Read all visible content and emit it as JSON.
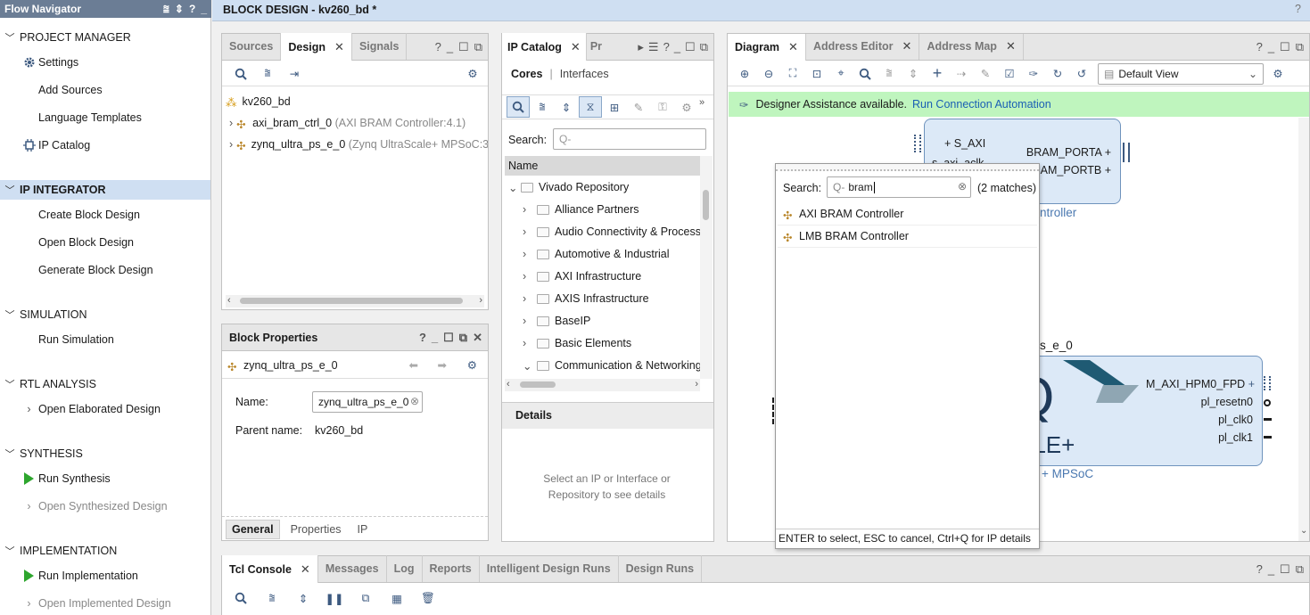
{
  "flow_navigator": {
    "title": "Flow Navigator",
    "sections": {
      "project_manager": "PROJECT MANAGER",
      "ip_integrator": "IP INTEGRATOR",
      "simulation": "SIMULATION",
      "rtl_analysis": "RTL ANALYSIS",
      "synthesis": "SYNTHESIS",
      "implementation": "IMPLEMENTATION"
    },
    "items": {
      "settings": "Settings",
      "add_sources": "Add Sources",
      "language_templates": "Language Templates",
      "ip_catalog": "IP Catalog",
      "create_block_design": "Create Block Design",
      "open_block_design": "Open Block Design",
      "generate_block_design": "Generate Block Design",
      "run_simulation": "Run Simulation",
      "open_elaborated_design": "Open Elaborated Design",
      "run_synthesis": "Run Synthesis",
      "open_synthesized_design": "Open Synthesized Design",
      "run_implementation": "Run Implementation",
      "open_implemented_design": "Open Implemented Design"
    }
  },
  "block_design_title": "BLOCK DESIGN - kv260_bd *",
  "sources_panel": {
    "tabs": [
      "Sources",
      "Design",
      "Signals"
    ],
    "root": "kv260_bd",
    "children": [
      {
        "name": "axi_bram_ctrl_0",
        "detail": "(AXI BRAM Controller:4.1)"
      },
      {
        "name": "zynq_ultra_ps_e_0",
        "detail": "(Zynq UltraScale+ MPSoC:3"
      }
    ]
  },
  "block_properties": {
    "title": "Block Properties",
    "selected": "zynq_ultra_ps_e_0",
    "name_label": "Name:",
    "name_value": "zynq_ultra_ps_e_0",
    "parent_label": "Parent name:",
    "parent_value": "kv260_bd",
    "tabs": [
      "General",
      "Properties",
      "IP"
    ]
  },
  "ip_catalog": {
    "tab": "IP Catalog",
    "tab2": "Pr",
    "cores": "Cores",
    "sep": "|",
    "interfaces": "Interfaces",
    "search_label": "Search:",
    "search_placeholder": "Q-",
    "name_header": "Name",
    "root": "Vivado Repository",
    "folders": [
      "Alliance Partners",
      "Audio Connectivity & Processi",
      "Automotive & Industrial",
      "AXI Infrastructure",
      "AXIS Infrastructure",
      "BaseIP",
      "Basic Elements",
      "Communication & Networking"
    ],
    "details_title": "Details",
    "details_hint": "Select an IP or Interface or Repository to see details"
  },
  "diagram": {
    "tabs": [
      "Diagram",
      "Address Editor",
      "Address Map"
    ],
    "view_select": "Default View",
    "assist_text": "Designer Assistance available.",
    "assist_link": "Run Connection Automation",
    "bram_block": {
      "ports_left": [
        "S_AXI",
        "s_axi_aclk"
      ],
      "ports_right": [
        "BRAM_PORTA",
        "BRAM_PORTB"
      ],
      "label_tail": "ntroller"
    },
    "zynq_block": {
      "label_head": "s_e_0",
      "ports_right": [
        "M_AXI_HPM0_FPD",
        "pl_resetn0",
        "pl_clk0",
        "pl_clk1"
      ],
      "logo_text": "Q",
      "logo_sub": "ALE+",
      "label_tail": "+ MPSoC"
    }
  },
  "add_ip_popup": {
    "search_label": "Search:",
    "search_value": "bram",
    "matches": "(2 matches)",
    "results": [
      "AXI BRAM Controller",
      "LMB BRAM Controller"
    ],
    "footer": "ENTER to select, ESC to cancel, Ctrl+Q for IP details"
  },
  "console": {
    "tabs": [
      "Tcl Console",
      "Messages",
      "Log",
      "Reports",
      "Intelligent Design Runs",
      "Design Runs"
    ]
  },
  "colors": {
    "selection_bg": "#cfdff2",
    "header_bg": "#6b7d95",
    "assist_bg": "#bff5be",
    "link": "#1a5fb4",
    "block_fill": "#dce9f7",
    "block_border": "#6f93bd",
    "run_green": "#2ea62e"
  }
}
